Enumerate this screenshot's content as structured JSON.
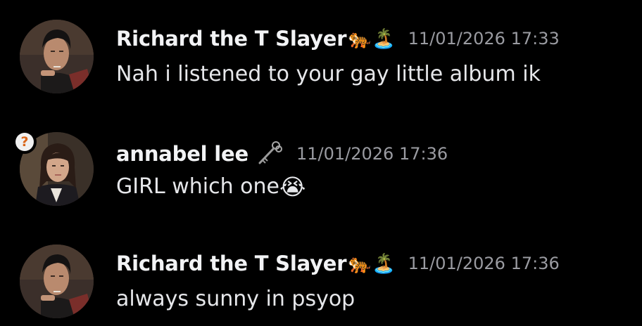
{
  "messages": [
    {
      "username": "Richard the T Slayer",
      "name_badges": "🐅🏝️",
      "timestamp": "11/01/2026 17:33",
      "text": "Nah i listened to your gay little album ik",
      "avatar": "man-smoking-avatar"
    },
    {
      "username": "annabel lee",
      "name_badges": "",
      "name_icon": "key-icon",
      "timestamp": "11/01/2026 17:36",
      "text": "GIRL which one",
      "text_emoji": "😭",
      "avatar": "woman-portrait-avatar",
      "status_badge": "?"
    },
    {
      "username": "Richard the T Slayer",
      "name_badges": "🐅🏝️",
      "timestamp": "11/01/2026 17:36",
      "text": "always sunny in psyop",
      "avatar": "man-smoking-avatar"
    }
  ]
}
